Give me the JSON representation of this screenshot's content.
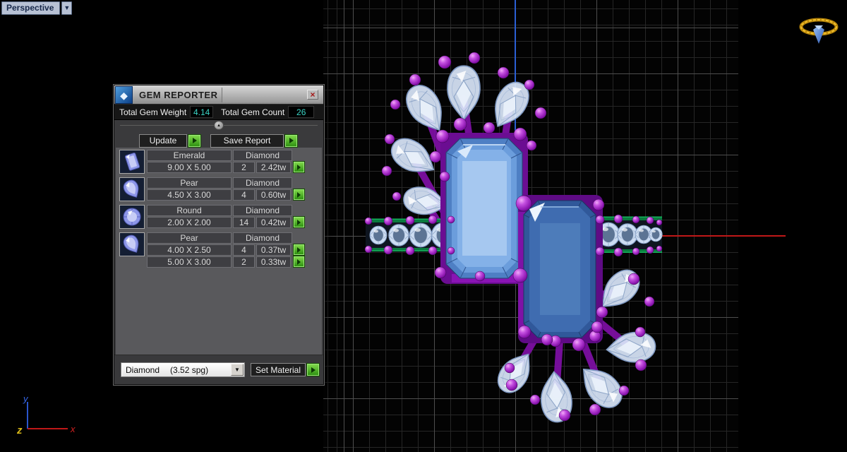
{
  "viewport": {
    "label": "Perspective",
    "dropdown_arrow": "▼"
  },
  "dialog": {
    "title": "GEM REPORTER",
    "close_glyph": "×",
    "app_icon_glyph": "◆",
    "totals": {
      "weight_label": "Total Gem Weight",
      "weight_value": "4.14",
      "count_label": "Total Gem Count",
      "count_value": "26"
    },
    "collapse_glyph": "▲",
    "buttons": {
      "update": "Update",
      "save_report": "Save Report",
      "set_material": "Set Material"
    },
    "material_dropdown": {
      "value": "Diamond",
      "detail": "(3.52 spg)",
      "arrow": "▼"
    },
    "rows": [
      {
        "icon": "emerald",
        "shape": "Emerald",
        "material": "Diamond",
        "sizes": [
          {
            "size": "9.00 X 5.00",
            "count": "2",
            "weight": "2.42tw"
          }
        ]
      },
      {
        "icon": "pear",
        "shape": "Pear",
        "material": "Diamond",
        "sizes": [
          {
            "size": "4.50 X 3.00",
            "count": "4",
            "weight": "0.60tw"
          }
        ]
      },
      {
        "icon": "round",
        "shape": "Round",
        "material": "Diamond",
        "sizes": [
          {
            "size": "2.00 X 2.00",
            "count": "14",
            "weight": "0.42tw"
          }
        ]
      },
      {
        "icon": "pear",
        "shape": "Pear",
        "material": "Diamond",
        "sizes": [
          {
            "size": "4.00 X 2.50",
            "count": "4",
            "weight": "0.37tw"
          },
          {
            "size": "5.00 X 3.00",
            "count": "2",
            "weight": "0.33tw"
          }
        ]
      }
    ]
  },
  "axis_gizmo": {
    "x_label": "x",
    "y_label": "y",
    "z_label": "z"
  },
  "palette": {
    "value_teal": "#3bd4c5",
    "play_green": "#3fae1f",
    "bead_purple": "#9b1fb8",
    "stone_light_blue": "#a6c8f0",
    "stone_dark_blue": "#4d7cba",
    "rail_green": "#0d8a4c",
    "axis_x_red": "#c01818",
    "axis_y_blue": "#2a5fd4",
    "logo_gold": "#d9a21a"
  }
}
